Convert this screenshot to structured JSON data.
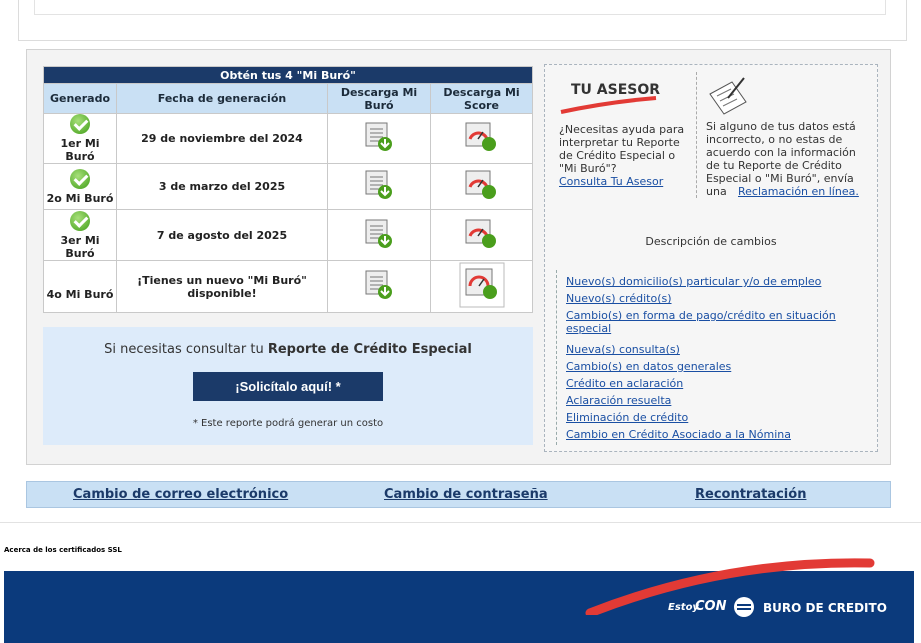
{
  "table": {
    "caption": "Obtén tus 4 \"Mi Buró\"",
    "headers": [
      "Generado",
      "Fecha de generación",
      "Descarga Mi Buró",
      "Descarga Mi Score"
    ],
    "rows": [
      {
        "label": "1er Mi Buró",
        "date": "29 de noviembre del 2024"
      },
      {
        "label": "2o Mi Buró",
        "date": "3 de marzo del 2025"
      },
      {
        "label": "3er Mi Buró",
        "date": "7 de agosto del 2025"
      },
      {
        "label": "4o Mi Buró",
        "date": "¡Tienes un nuevo \"Mi Buró\" disponible!"
      }
    ]
  },
  "special": {
    "text_prefix": "Si necesitas consultar tu ",
    "text_bold": "Reporte de Crédito Especial",
    "button": "¡Solicítalo aquí! *",
    "note": "* Este reporte podrá generar un costo"
  },
  "asesor": {
    "logo": "TU ASESOR",
    "text": "¿Necesitas ayuda para interpretar tu Reporte de Crédito Especial o \"Mi Buró\"?",
    "link": "Consulta Tu Asesor"
  },
  "reclamo": {
    "text": "Si alguno de tus datos está incorrecto, o no estas de acuerdo con la información de tu Reporte de Crédito Especial o \"Mi Buró\", envía una",
    "link": "Reclamación en línea."
  },
  "changes": {
    "title": "Descripción de cambios",
    "items": [
      "Nuevo(s) domicilio(s) particular y/o de empleo",
      "Nuevo(s) crédito(s)",
      "Cambio(s) en forma de pago/crédito en situación especial",
      "Nueva(s) consulta(s)",
      "Cambio(s) en datos generales",
      "Crédito en aclaración",
      "Aclaración resuelta",
      "Eliminación de crédito",
      "Cambio en Crédito Asociado a la Nómina"
    ]
  },
  "bottom_links": [
    "Cambio de correo electrónico",
    "Cambio de contraseña",
    "Recontratación"
  ],
  "ssl": "Acerca de los certificados SSL",
  "footer": {
    "estoy": "Estoy",
    "con": "CON",
    "brand": "BURO DE CREDITO"
  },
  "colors": {
    "navy": "#1b3a69",
    "light_blue": "#c9e0f4",
    "green": "#2d7e12",
    "footer": "#0b3a7c",
    "swoosh": "#e23a35"
  }
}
